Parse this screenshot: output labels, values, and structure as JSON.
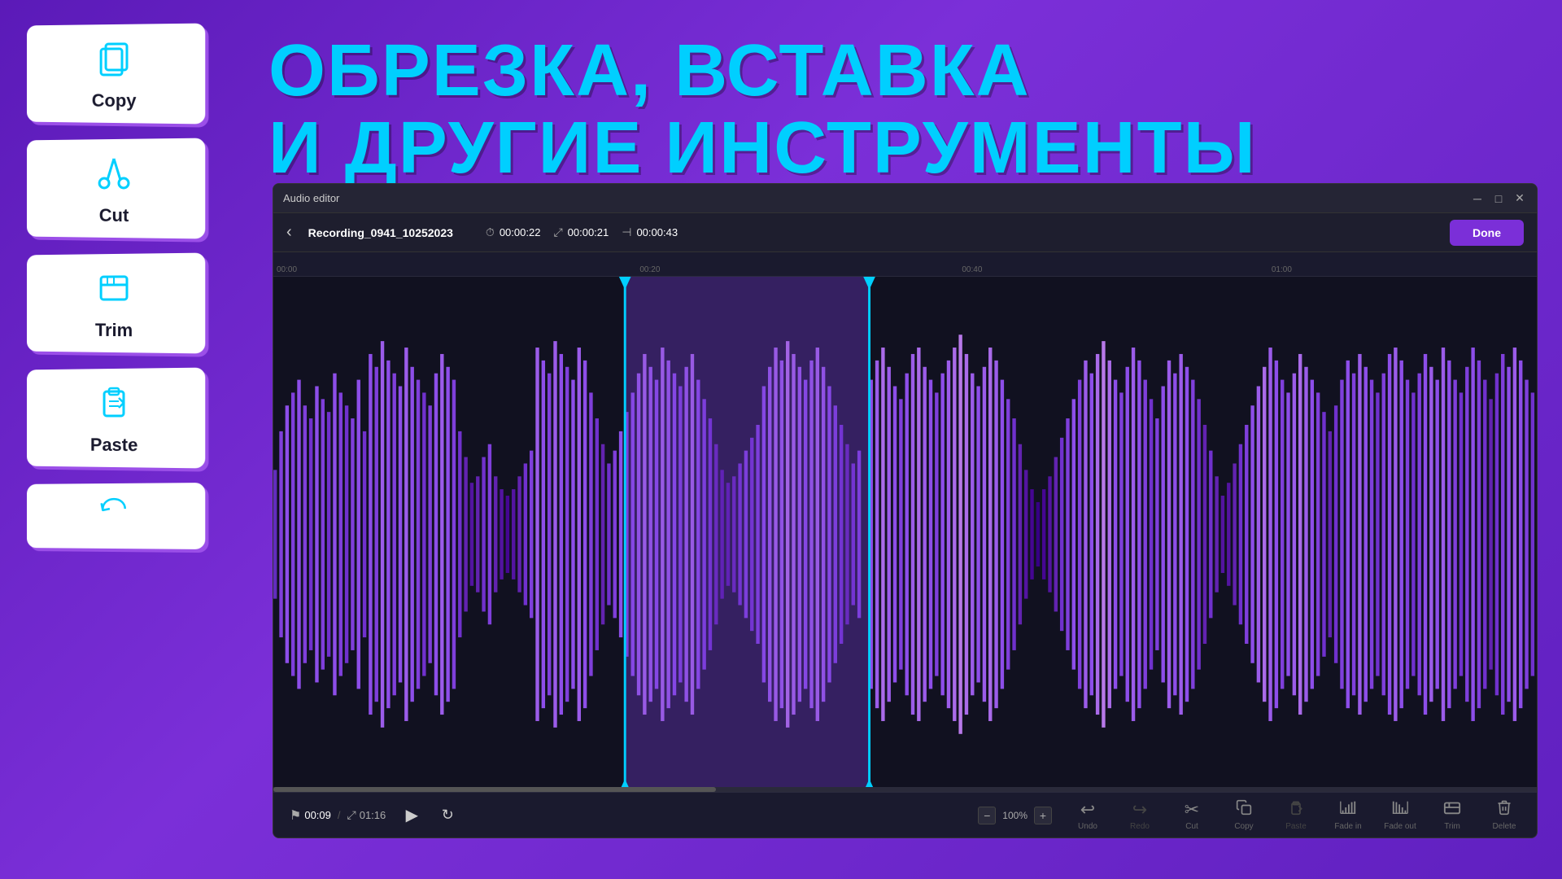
{
  "background_color": "#6B21C8",
  "title": {
    "line1": "ОБРЕЗКА, ВСТАВКА",
    "line2": "И ДРУГИЕ ИНСТРУМЕНТЫ"
  },
  "tools": [
    {
      "id": "copy",
      "label": "Copy",
      "icon": "copy"
    },
    {
      "id": "cut",
      "label": "Cut",
      "icon": "cut"
    },
    {
      "id": "trim",
      "label": "Trim",
      "icon": "trim"
    },
    {
      "id": "paste",
      "label": "Paste",
      "icon": "paste"
    },
    {
      "id": "undo",
      "label": "",
      "icon": "undo"
    }
  ],
  "editor": {
    "title": "Audio editor",
    "filename": "Recording_0941_10252023",
    "time_start": "00:00:22",
    "time_duration": "00:00:21",
    "time_end": "00:00:43",
    "done_label": "Done",
    "current_time": "00:09",
    "total_time": "01:16",
    "zoom": "100%",
    "ruler_marks": [
      "00:00",
      "00:20",
      "00:40",
      "01:00"
    ],
    "toolbar_items": [
      {
        "id": "undo",
        "label": "Undo",
        "icon": "↩",
        "disabled": false
      },
      {
        "id": "redo",
        "label": "Redo",
        "icon": "↪",
        "disabled": true
      },
      {
        "id": "cut",
        "label": "Cut",
        "icon": "✂",
        "disabled": false
      },
      {
        "id": "copy",
        "label": "Copy",
        "icon": "⧉",
        "disabled": false
      },
      {
        "id": "paste",
        "label": "Paste",
        "icon": "⬆",
        "disabled": true
      },
      {
        "id": "fade-in",
        "label": "Fade in",
        "icon": "▶",
        "disabled": false
      },
      {
        "id": "fade-out",
        "label": "Fade out",
        "icon": "◀",
        "disabled": false
      },
      {
        "id": "trim",
        "label": "Trim",
        "icon": "⊟",
        "disabled": false
      },
      {
        "id": "delete",
        "label": "Delete",
        "icon": "🗑",
        "disabled": false
      }
    ]
  }
}
